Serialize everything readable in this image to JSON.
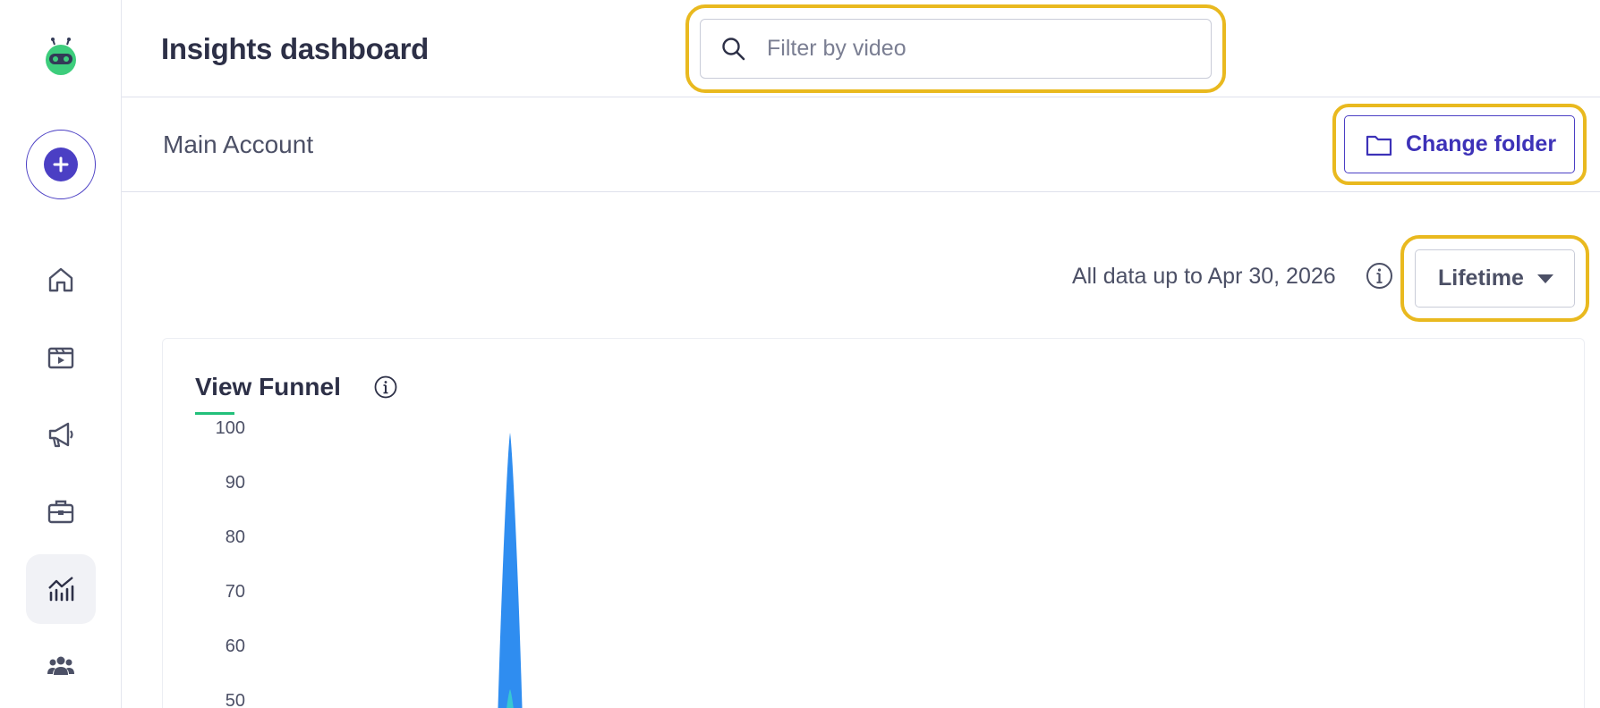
{
  "app": {
    "title": "Insights dashboard"
  },
  "header": {
    "title": "Insights dashboard",
    "search": {
      "placeholder": "Filter by video",
      "value": ""
    }
  },
  "sidebar": {
    "logo_icon": "robot-logo-icon",
    "create_icon": "plus-icon",
    "items": [
      {
        "icon": "home-icon",
        "active": false
      },
      {
        "icon": "video-clapper-icon",
        "active": false
      },
      {
        "icon": "megaphone-icon",
        "active": false
      },
      {
        "icon": "briefcase-icon",
        "active": false
      },
      {
        "icon": "analytics-chart-icon",
        "active": true
      },
      {
        "icon": "team-icon",
        "active": false
      }
    ]
  },
  "account": {
    "name": "Main Account",
    "change_folder_label": "Change folder"
  },
  "range": {
    "text": "All data up to Apr 30, 2026",
    "selected": "Lifetime"
  },
  "card": {
    "title": "View Funnel"
  },
  "chart_data": {
    "type": "area",
    "title": "View Funnel",
    "xlabel": "",
    "ylabel": "",
    "y_ticks": [
      "100",
      "90",
      "80",
      "70",
      "60",
      "50"
    ],
    "ylim": [
      0,
      100
    ],
    "series": [
      {
        "peak_value": 99
      }
    ]
  },
  "colors": {
    "brand": "#4b3fc4",
    "highlight": "#e9b91f",
    "accent_green": "#22c07a",
    "chart_blue": "#2f8df0"
  }
}
